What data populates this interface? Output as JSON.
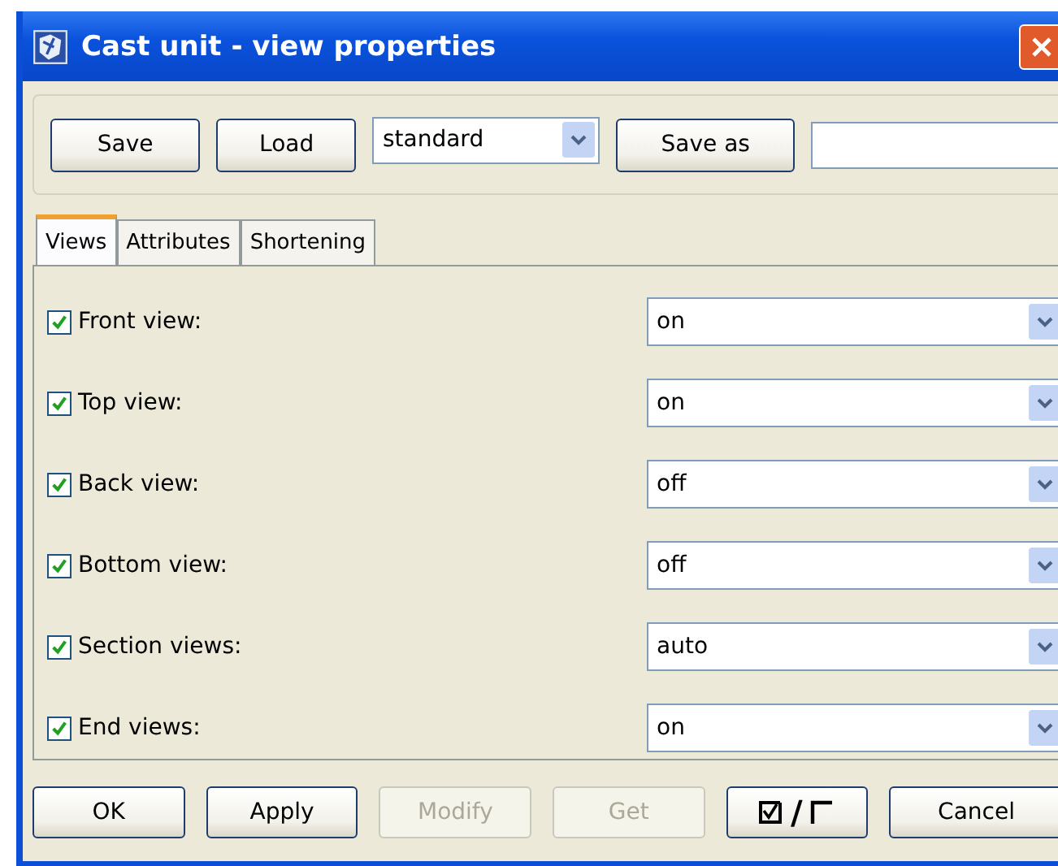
{
  "window": {
    "title": "Cast unit - view properties"
  },
  "toolbar": {
    "save": "Save",
    "load": "Load",
    "preset": "standard",
    "save_as": "Save as"
  },
  "tabs": [
    {
      "label": "Views",
      "selected": true
    },
    {
      "label": "Attributes",
      "selected": false
    },
    {
      "label": "Shortening",
      "selected": false
    }
  ],
  "views": [
    {
      "label": "Front view:",
      "checked": true,
      "value": "on"
    },
    {
      "label": "Top view:",
      "checked": true,
      "value": "on"
    },
    {
      "label": "Back view:",
      "checked": true,
      "value": "off"
    },
    {
      "label": "Bottom view:",
      "checked": true,
      "value": "off"
    },
    {
      "label": "Section views:",
      "checked": true,
      "value": "auto"
    },
    {
      "label": "End views:",
      "checked": true,
      "value": "on"
    }
  ],
  "buttons": [
    {
      "label": "OK",
      "disabled": false
    },
    {
      "label": "Apply",
      "disabled": false
    },
    {
      "label": "Modify",
      "disabled": true
    },
    {
      "label": "Get",
      "disabled": true
    }
  ],
  "toggle_button": {
    "separator": "/"
  },
  "cancel": "Cancel"
}
